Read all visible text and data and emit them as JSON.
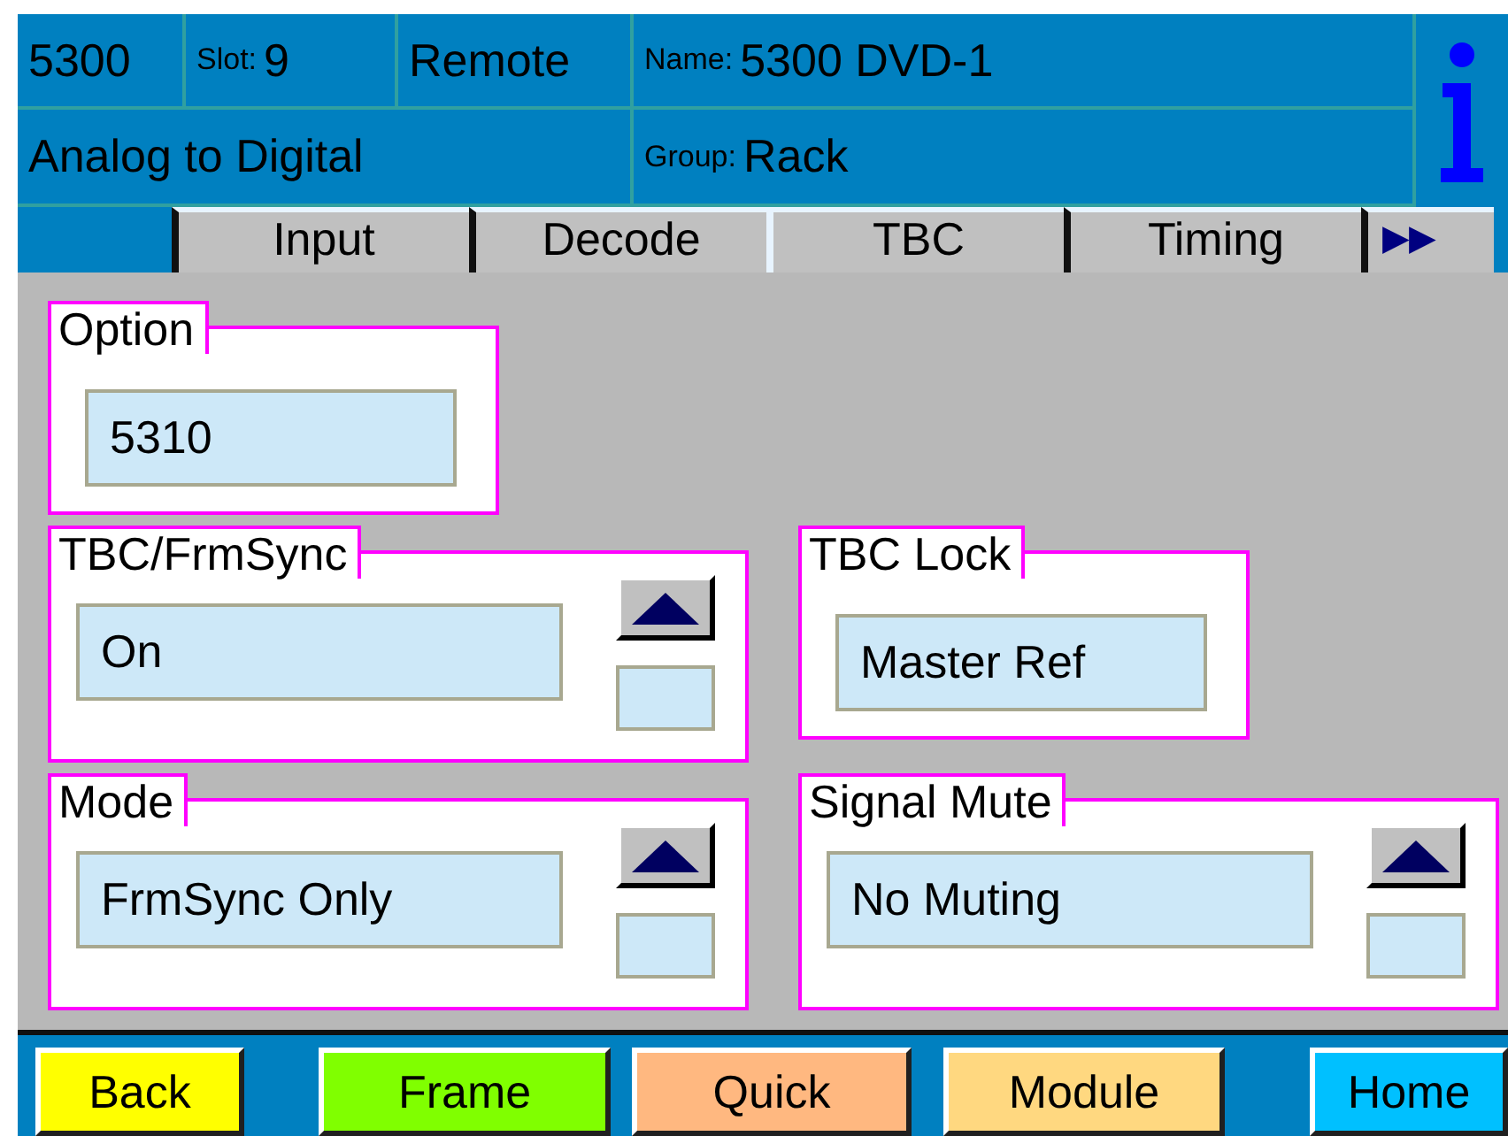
{
  "header": {
    "model": "5300",
    "slot_label": "Slot:",
    "slot": "9",
    "control": "Remote",
    "name_label": "Name:",
    "name": "5300 DVD-1",
    "type": "Analog to Digital",
    "group_label": "Group:",
    "group": "Rack"
  },
  "tabs": [
    {
      "label": "Input",
      "selected": false
    },
    {
      "label": "Decode",
      "selected": false
    },
    {
      "label": "TBC",
      "selected": true
    },
    {
      "label": "Timing",
      "selected": false
    }
  ],
  "more_tabs": "▶▶",
  "panel_rows": [
    [
      {
        "title": "Option",
        "value": "5310",
        "kind": "field"
      }
    ],
    [
      {
        "title": "TBC/FrmSync",
        "value": "On",
        "kind": "spinner"
      },
      {
        "title": "TBC Lock",
        "value": "Master Ref",
        "kind": "field"
      }
    ],
    [
      {
        "title": "Mode",
        "value": "FrmSync Only",
        "kind": "spinner"
      },
      {
        "title": "Signal Mute",
        "value": "No Muting",
        "kind": "spinner"
      }
    ]
  ],
  "buttons": [
    {
      "label": "Back",
      "color": "#ffff00"
    },
    {
      "label": "Frame",
      "color": "#80ff00"
    },
    {
      "label": "Quick",
      "color": "#ffb880"
    },
    {
      "label": "Module",
      "color": "#ffd880"
    },
    {
      "label": "Home",
      "color": "#00c0ff"
    }
  ]
}
